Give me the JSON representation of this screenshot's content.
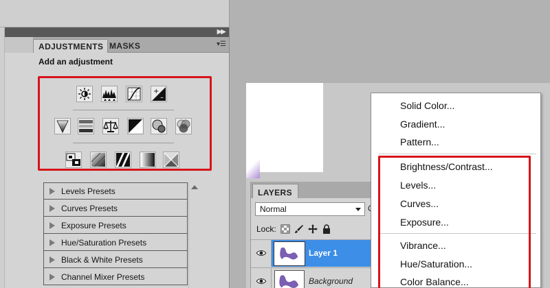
{
  "adjustments_panel": {
    "tabs": [
      {
        "label": "ADJUSTMENTS",
        "active": true
      },
      {
        "label": "MASKS",
        "active": false
      }
    ],
    "heading": "Add an adjustment",
    "icon_rows": [
      [
        "brightness-contrast-icon",
        "levels-icon",
        "curves-icon",
        "exposure-icon"
      ],
      [
        "vibrance-icon",
        "hue-saturation-icon",
        "color-balance-icon",
        "black-white-icon",
        "photo-filter-icon",
        "channel-mixer-icon"
      ],
      [
        "invert-icon",
        "posterize-icon",
        "threshold-icon",
        "gradient-map-icon",
        "selective-color-icon"
      ]
    ],
    "presets": [
      "Levels Presets",
      "Curves Presets",
      "Exposure Presets",
      "Hue/Saturation Presets",
      "Black & White Presets",
      "Channel Mixer Presets"
    ],
    "highlight_color": "#d6141b"
  },
  "layers_panel": {
    "tab": "LAYERS",
    "blend_mode": "Normal",
    "opacity_label_partial": "O",
    "lock_label": "Lock:",
    "layers": [
      {
        "name": "Layer 1",
        "selected": true,
        "visible": true
      },
      {
        "name": "Background",
        "selected": false,
        "visible": true
      }
    ],
    "selection_color": "#3d8ee6"
  },
  "context_menu": {
    "groups": [
      [
        "Solid Color...",
        "Gradient...",
        "Pattern..."
      ],
      [
        "Brightness/Contrast...",
        "Levels...",
        "Curves...",
        "Exposure..."
      ],
      [
        "Vibrance...",
        "Hue/Saturation...",
        "Color Balance..."
      ]
    ]
  }
}
